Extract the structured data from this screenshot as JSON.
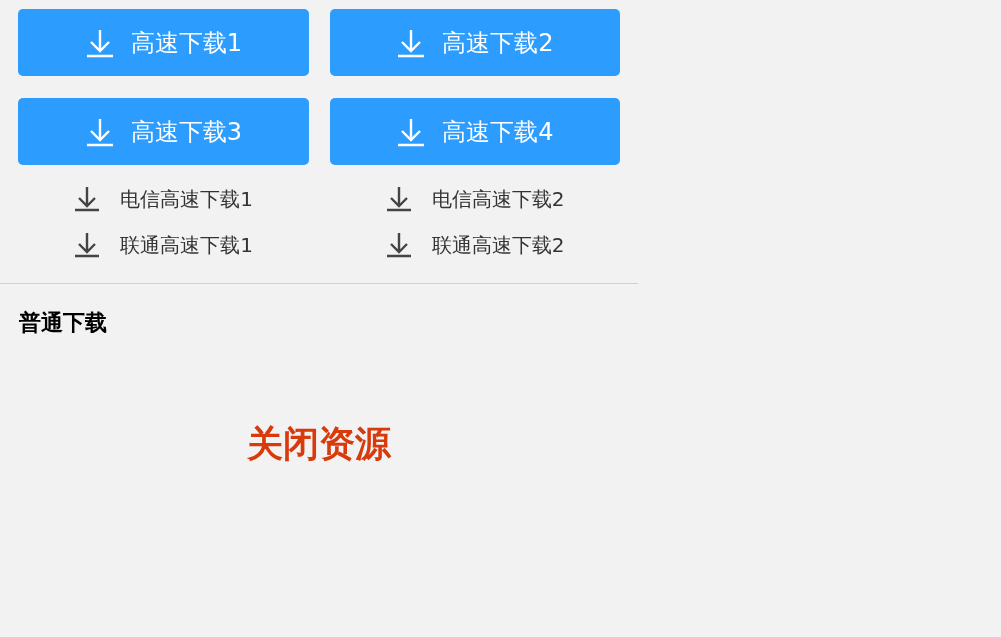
{
  "fast_buttons": [
    "高速下载1",
    "高速下载2",
    "高速下载3",
    "高速下载4"
  ],
  "mirror_links": [
    "电信高速下载1",
    "电信高速下载2",
    "联通高速下载1",
    "联通高速下载2"
  ],
  "normal_download": {
    "heading": "普通下载",
    "notice": "关闭资源"
  }
}
